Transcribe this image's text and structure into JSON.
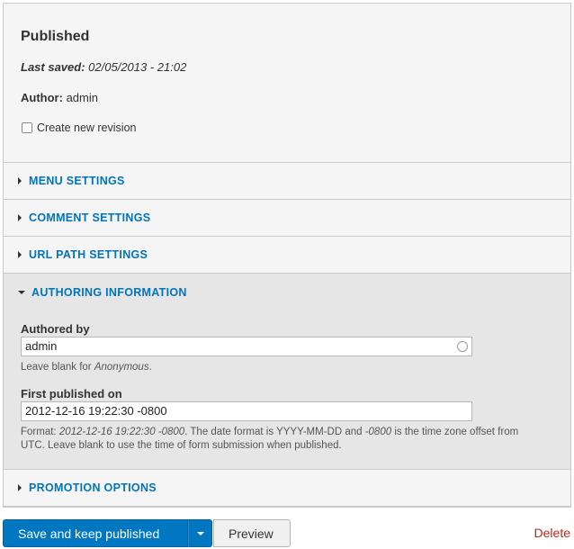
{
  "meta": {
    "status_title": "Published",
    "last_saved_label": "Last saved:",
    "last_saved_value": "02/05/2013 - 21:02",
    "author_label": "Author:",
    "author_value": "admin",
    "revision_checkbox_label": "Create new revision",
    "revision_checked": false
  },
  "sections": {
    "menu": "MENU SETTINGS",
    "comment": "COMMENT SETTINGS",
    "url": "URL PATH SETTINGS",
    "authoring": "AUTHORING INFORMATION",
    "promotion": "PROMOTION OPTIONS"
  },
  "authoring": {
    "authored_by_label": "Authored by",
    "authored_by_value": "admin",
    "authored_by_help_prefix": "Leave blank for ",
    "authored_by_help_em": "Anonymous",
    "authored_by_help_suffix": ".",
    "published_label": "First published on",
    "published_value": "2012-12-16 19:22:30 -0800",
    "published_help_1": "Format: ",
    "published_help_2": "2012-12-16 19:22:30 -0800",
    "published_help_3": ". The date format is YYYY-MM-DD and ",
    "published_help_4": "-0800",
    "published_help_5": " is the time zone offset from UTC. Leave blank to use the time of form submission when published."
  },
  "actions": {
    "save_label": "Save and keep published",
    "preview_label": "Preview",
    "delete_label": "Delete"
  },
  "colors": {
    "link": "#0074bd",
    "primary_button": "#0077c0",
    "delete": "#c4271b"
  }
}
